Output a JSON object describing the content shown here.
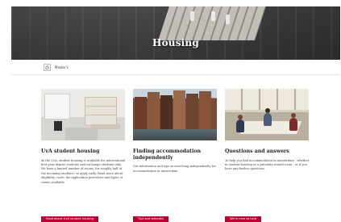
{
  "hero": {
    "title": "Housing"
  },
  "breadcrumb": {
    "home_icon": "home-icon",
    "current": "Master's"
  },
  "cards": [
    {
      "title": "UvA student housing",
      "body": "At the UvA, student housing is available for international first year degree students and exchange students only. We have a limited number of rooms, for roughly half of the incoming students, so apply early. Read more about eligibility, costs, the application procedure and types of rooms available.",
      "button": "Read about UvA student housing"
    },
    {
      "title": "Finding accommodation independently",
      "body": "Get information and tips on searching independently for accommodation in Amsterdam.",
      "button": "Tips and websites"
    },
    {
      "title": "Questions and answers",
      "body": "To help you find accommodation in Amsterdam - whether in student housing or a privately rented room - or if you have any further questions.",
      "button": "We're here to help"
    }
  ],
  "colors": {
    "accent": "#bd0032"
  }
}
